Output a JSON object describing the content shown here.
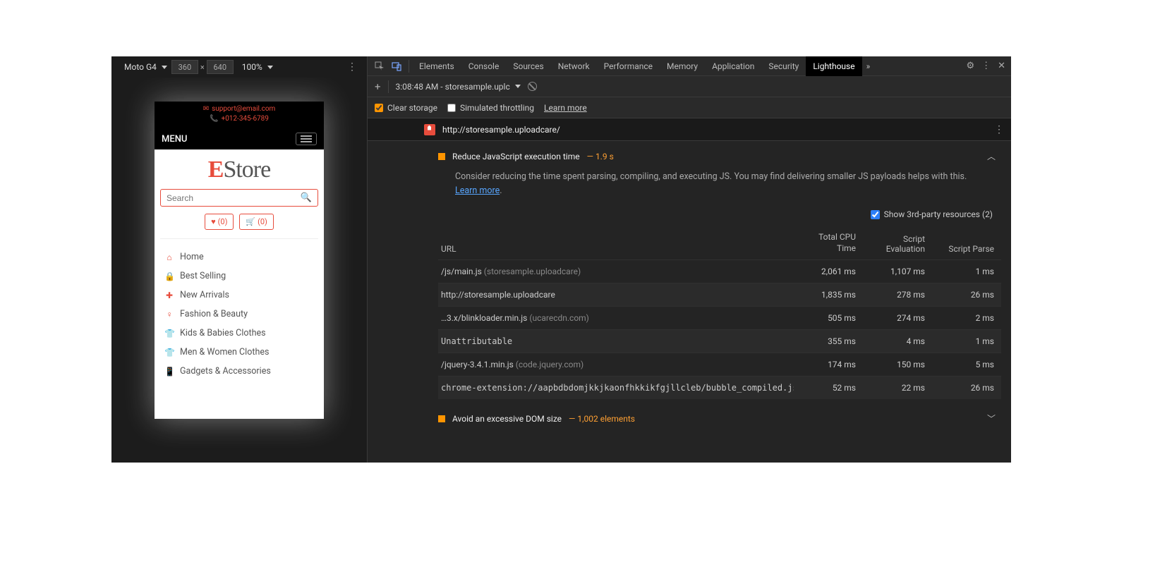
{
  "device": {
    "name": "Moto G4",
    "width": "360",
    "height": "640",
    "zoom": "100%"
  },
  "site": {
    "email": "support@email.com",
    "phone": "+012-345-6789",
    "menu_label": "MENU",
    "brand_accent": "E",
    "brand_rest": "Store",
    "search_placeholder": "Search",
    "fav_count": "(0)",
    "cart_count": "(0)",
    "categories": [
      {
        "icon": "home-icon",
        "glyph": "⌂",
        "label": "Home"
      },
      {
        "icon": "bag-icon",
        "glyph": "🔒",
        "label": "Best Selling"
      },
      {
        "icon": "plus-icon",
        "glyph": "✚",
        "label": "New Arrivals"
      },
      {
        "icon": "dress-icon",
        "glyph": "♀",
        "label": "Fashion & Beauty"
      },
      {
        "icon": "tshirt-icon",
        "glyph": "👕",
        "label": "Kids & Babies Clothes"
      },
      {
        "icon": "shirt-icon",
        "glyph": "👕",
        "label": "Men & Women Clothes"
      },
      {
        "icon": "mobile-icon",
        "glyph": "📱",
        "label": "Gadgets & Accessories"
      }
    ]
  },
  "devtools": {
    "tabs": [
      "Elements",
      "Console",
      "Sources",
      "Network",
      "Performance",
      "Memory",
      "Application",
      "Security",
      "Lighthouse"
    ],
    "active_tab": "Lighthouse",
    "report_label": "3:08:48 AM - storesample.uplc",
    "clear_storage": "Clear storage",
    "sim_throttling": "Simulated throttling",
    "learn_more": "Learn more",
    "report_url": "http://storesample.uploadcare/",
    "thirdparty_label": "Show 3rd-party resources (2)",
    "audit1": {
      "title": "Reduce JavaScript execution time",
      "metric": "— 1.9 s",
      "desc_a": "Consider reducing the time spent parsing, compiling, and executing JS. You may find delivering smaller JS payloads helps with this. ",
      "desc_link": "Learn more"
    },
    "audit2": {
      "title": "Avoid an excessive DOM size",
      "metric": "— 1,002 elements"
    },
    "table": {
      "headers": {
        "url": "URL",
        "cpu": "Total CPU Time",
        "eval": "Script Evaluation",
        "parse": "Script Parse"
      },
      "rows": [
        {
          "url": "/js/main.js",
          "origin": "(storesample.uploadcare)",
          "mono": false,
          "cpu": "2,061 ms",
          "eval": "1,107 ms",
          "parse": "1 ms",
          "shade": false
        },
        {
          "url": "http://storesample.uploadcare",
          "origin": "",
          "mono": false,
          "cpu": "1,835 ms",
          "eval": "278 ms",
          "parse": "26 ms",
          "shade": true
        },
        {
          "url": "…3.x/blinkloader.min.js",
          "origin": "(ucarecdn.com)",
          "mono": false,
          "cpu": "505 ms",
          "eval": "274 ms",
          "parse": "2 ms",
          "shade": false
        },
        {
          "url": "Unattributable",
          "origin": "",
          "mono": true,
          "cpu": "355 ms",
          "eval": "4 ms",
          "parse": "1 ms",
          "shade": true
        },
        {
          "url": "/jquery-3.4.1.min.js",
          "origin": "(code.jquery.com)",
          "mono": false,
          "cpu": "174 ms",
          "eval": "150 ms",
          "parse": "5 ms",
          "shade": false
        },
        {
          "url": "chrome-extension://aapbdbdomjkkjkaonfhkkikfgjllcleb/bubble_compiled.js",
          "origin": "",
          "mono": true,
          "cpu": "52 ms",
          "eval": "22 ms",
          "parse": "26 ms",
          "shade": true
        }
      ]
    }
  }
}
